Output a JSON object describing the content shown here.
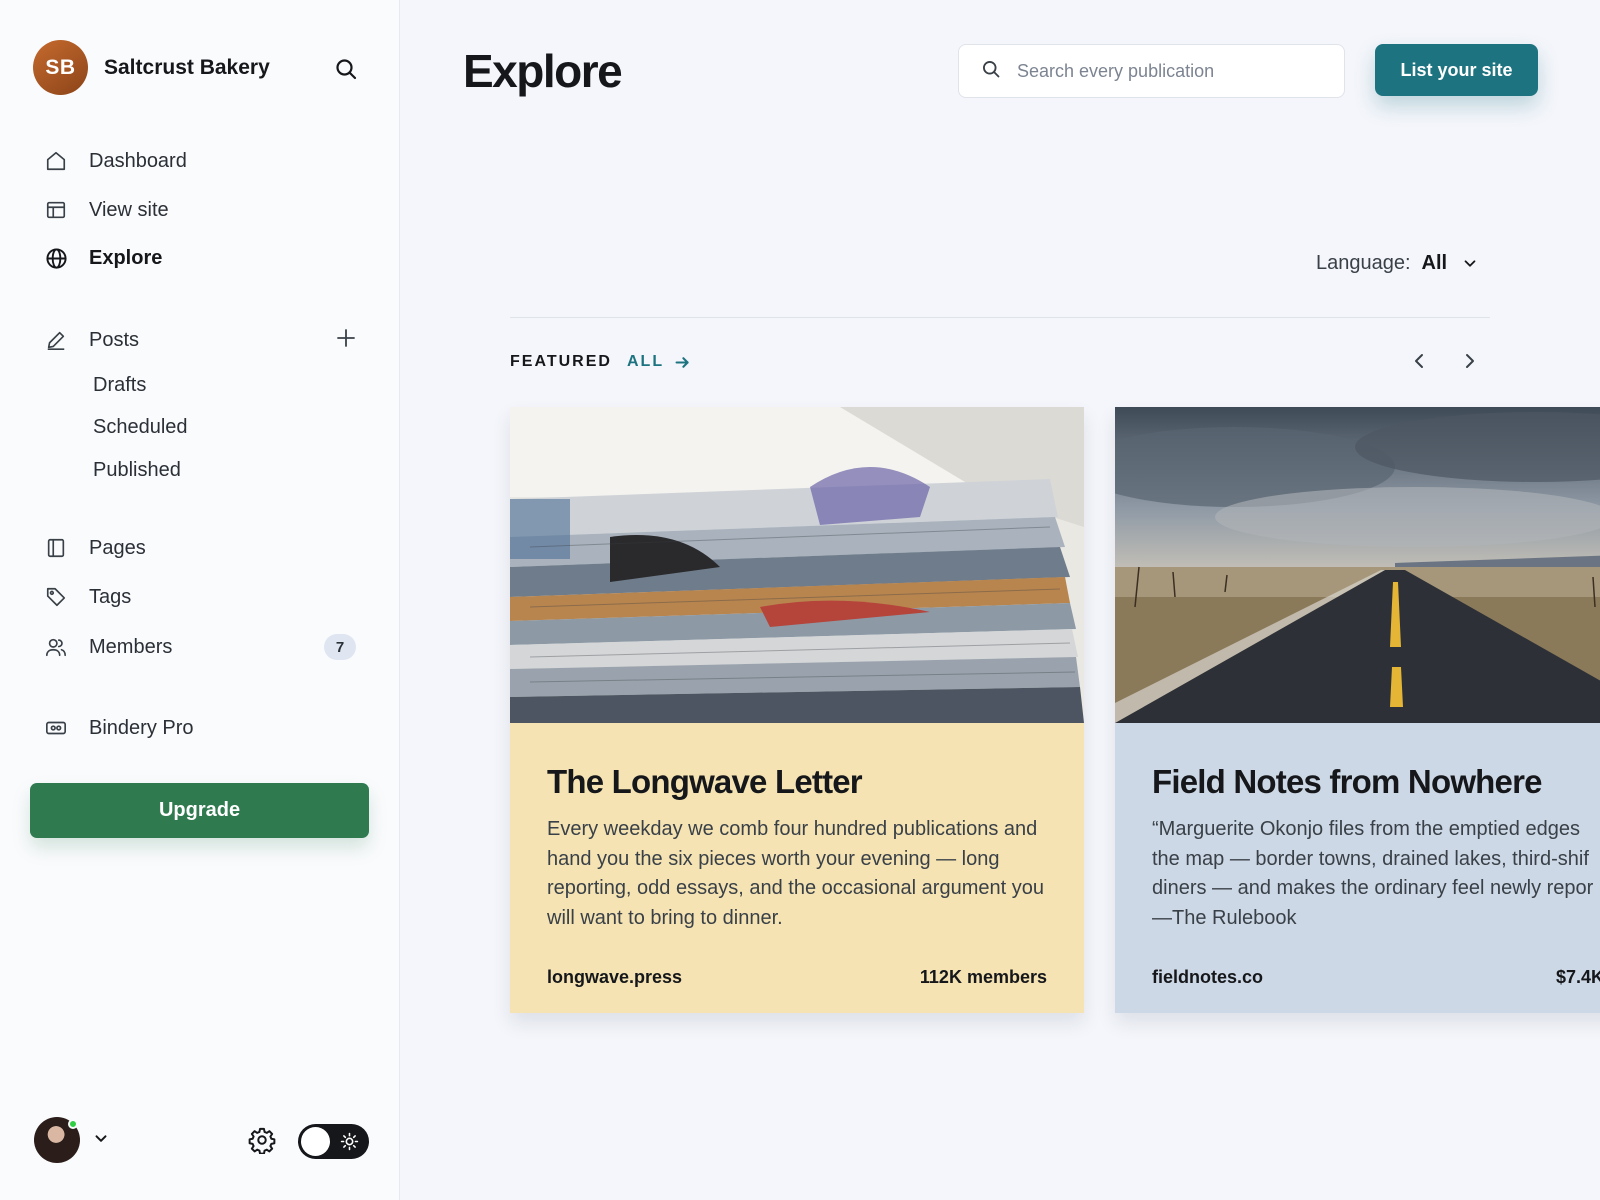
{
  "sidebar": {
    "site_initials": "SB",
    "site_name": "Saltcrust Bakery",
    "nav": {
      "dashboard": "Dashboard",
      "view_site": "View site",
      "explore": "Explore",
      "posts": "Posts",
      "drafts": "Drafts",
      "scheduled": "Scheduled",
      "published": "Published",
      "pages": "Pages",
      "tags": "Tags",
      "members": "Members",
      "members_count": "7",
      "bindery_pro": "Bindery Pro"
    },
    "upgrade_label": "Upgrade",
    "footer": {
      "online": true,
      "theme": "light"
    },
    "icons": [
      "search-icon",
      "home-icon",
      "layout-icon",
      "globe-icon",
      "pen-icon",
      "plus-icon",
      "page-icon",
      "tag-icon",
      "members-icon",
      "credit-card-icon",
      "chevron-down-icon",
      "gear-icon",
      "sun-icon"
    ]
  },
  "header": {
    "title": "Explore",
    "search_placeholder": "Search every publication",
    "list_site_label": "List your site"
  },
  "filters": {
    "language_label": "Language:",
    "language_value": "All"
  },
  "featured": {
    "label": "FEATURED",
    "all_label": "ALL",
    "cards": [
      {
        "title": "The Longwave Letter",
        "description": "Every weekday we comb four hundred publications and hand you the six pieces worth your evening — long reporting, odd essays, and the occasional argument you will want to bring to dinner.",
        "domain": "longwave.press",
        "stat": "112K members",
        "image": "stack-of-newspapers",
        "color": "#f5e3b3"
      },
      {
        "title": "Field Notes from Nowhere",
        "description_lines": [
          "“Marguerite Okonjo files from the emptied edges",
          "the map — border towns, drained lakes, third-shif",
          "diners — and makes the ordinary feel newly repor",
          "—The Rulebook"
        ],
        "domain": "fieldnotes.co",
        "stat": "$7.4K",
        "image": "empty-desert-road",
        "color": "#cdd8e6"
      }
    ]
  },
  "colors": {
    "accent": "#1d7480",
    "upgrade": "#2f7a4f",
    "background": "#f4f6fb"
  }
}
